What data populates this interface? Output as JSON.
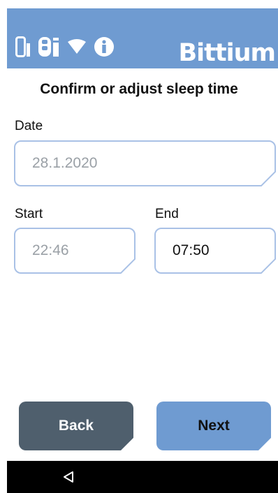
{
  "header": {
    "brand": "Bittium",
    "background_color": "#6f9bd1",
    "status_icons": [
      "phone-icon",
      "sensor-icon",
      "wifi-icon",
      "info-icon"
    ]
  },
  "title": "Confirm or adjust sleep time",
  "date": {
    "label": "Date",
    "value": "28.1.2020"
  },
  "start": {
    "label": "Start",
    "value": "22:46"
  },
  "end": {
    "label": "End",
    "value": "07:50"
  },
  "buttons": {
    "back_label": "Back",
    "back_color": "#4f5f6d",
    "next_label": "Next",
    "next_color": "#6f9bd1"
  },
  "navbar": {
    "back_icon": "triangle-back-icon"
  }
}
